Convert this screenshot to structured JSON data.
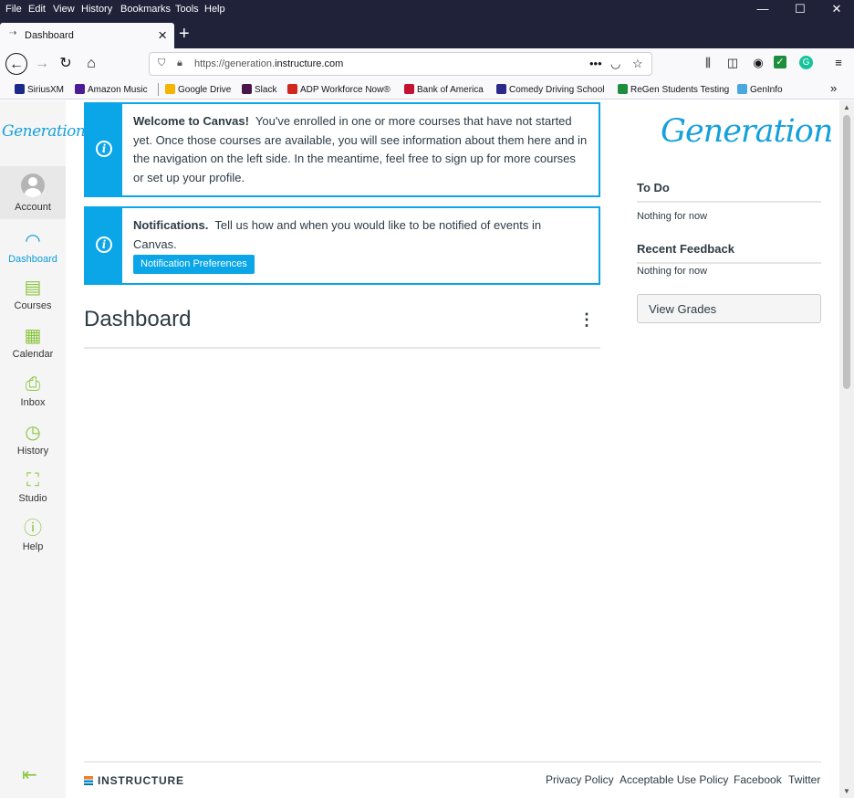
{
  "menubar": {
    "items": [
      "File",
      "Edit",
      "View",
      "History",
      "Bookmarks",
      "Tools",
      "Help"
    ]
  },
  "tab": {
    "title": "Dashboard"
  },
  "address": {
    "prefix": "https://generation.",
    "domain": "instructure.com"
  },
  "bookmarks": [
    {
      "label": "SiriusXM",
      "color": "#1b2a8a"
    },
    {
      "label": "Amazon Music",
      "color": "#4a1d96"
    },
    {
      "label": "Google Drive",
      "color": "#f4b400"
    },
    {
      "label": "Slack",
      "color": "#4a154b"
    },
    {
      "label": "ADP Workforce Now®",
      "color": "#d0271d"
    },
    {
      "label": "Bank of America",
      "color": "#c41230"
    },
    {
      "label": "Comedy Driving School",
      "color": "#2a2a8a"
    },
    {
      "label": "ReGen Students Testing",
      "color": "#1e8e3e"
    },
    {
      "label": "GenInfo",
      "color": "#4aa8e0"
    }
  ],
  "sidenav": {
    "logo": "Generation",
    "items": [
      {
        "label": "Account"
      },
      {
        "label": "Dashboard"
      },
      {
        "label": "Courses"
      },
      {
        "label": "Calendar"
      },
      {
        "label": "Inbox"
      },
      {
        "label": "History"
      },
      {
        "label": "Studio"
      },
      {
        "label": "Help"
      }
    ]
  },
  "alerts": {
    "welcome": {
      "title": "Welcome to Canvas!",
      "text": "You've enrolled in one or more courses that have not started yet. Once those courses are available, you will see information about them here and in the navigation on the left side. In the meantime, feel free to sign up for more courses or set up your profile."
    },
    "notifications": {
      "title": "Notifications.",
      "text": "Tell us how and when you would like to be notified of events in Canvas.",
      "button": "Notification Preferences"
    }
  },
  "dashboard": {
    "title": "Dashboard"
  },
  "right": {
    "logo": "Generation",
    "todo": {
      "title": "To Do",
      "empty": "Nothing for now"
    },
    "feedback": {
      "title": "Recent Feedback",
      "empty": "Nothing for now"
    },
    "grades_button": "View Grades"
  },
  "footer": {
    "brand": "INSTRUCTURE",
    "links": [
      "Privacy Policy",
      "Acceptable Use Policy",
      "Facebook",
      "Twitter"
    ]
  },
  "colors": {
    "canvas_blue": "#0aa6e8",
    "nav_green": "#8bc53f",
    "chrome_dark": "#1f2238"
  }
}
